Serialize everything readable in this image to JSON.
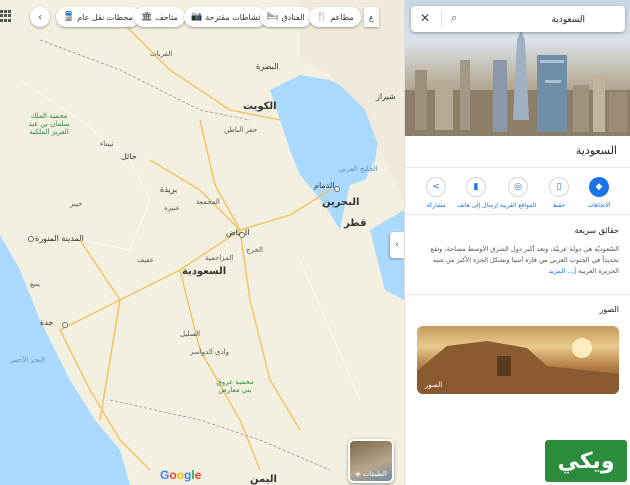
{
  "map": {
    "chips": [
      {
        "label": "مطاعم",
        "icon": "fork-knife-icon"
      },
      {
        "label": "الفنادق",
        "icon": "bed-icon"
      },
      {
        "label": "نشاطات مقترحة",
        "icon": "camera-icon"
      },
      {
        "label": "متاحف",
        "icon": "museum-icon"
      },
      {
        "label": "محطات نقل عام",
        "icon": "train-icon"
      }
    ],
    "labels": {
      "basra": "البصرة",
      "shiraz": "شيراز",
      "kuwait": "الكويت",
      "hafr": "حفر الباطن",
      "qurayyat": "القريات",
      "gulf": "الخليج العربي",
      "dammam": "الدمام",
      "bahrain": "البحرين",
      "qatar": "قطر",
      "hail": "حائل",
      "buraydah": "بريدة",
      "majmaah": "المجمعة",
      "unayzah": "عنيزة",
      "riyadh": "الرياض",
      "kharj": "الخرج",
      "muzahimiyah": "المزاحمية",
      "afif": "عفيف",
      "saudi": "السعودية",
      "madinah": "المدينة المنورة",
      "yanbu": "ينبع",
      "jeddah": "جدة",
      "redsea": "البحر الأحمر",
      "sulayyil": "السليل",
      "wadi": "وادي الدواسر",
      "reserve1": "محمية الملك سلمان بن عبد العزيز الملكية",
      "reserve2": "محمية عروق بني معارض",
      "yemen": "اليمن",
      "tayma": "تيماء",
      "khaybar": "خيبر"
    },
    "layers_label": "الطبقات"
  },
  "panel": {
    "search_value": "السعودية",
    "title": "السعودية",
    "actions": [
      {
        "label": "الاتجاهات",
        "icon": "directions-icon"
      },
      {
        "label": "حفظ",
        "icon": "bookmark-icon"
      },
      {
        "label": "المواقع القريبة",
        "icon": "nearby-icon"
      },
      {
        "label": "إرسال إلى هاتف",
        "icon": "phone-icon"
      },
      {
        "label": "مشاركة",
        "icon": "share-icon"
      }
    ],
    "facts_title": "حقائق سريعة",
    "facts_text": "السّعوديّة هي دولة عربيّة، وتعد أكبر دول الشرق الأوسط مساحة، وتقع تحديداً في الجنوب الغربي من قارة آسيا وتشكل الجزء الأكبر من شبه الجزيرة العربية ",
    "facts_more": "[... المزيد",
    "photos_title": "الصور",
    "photo_label": "الصور"
  },
  "watermark": "ويكي"
}
